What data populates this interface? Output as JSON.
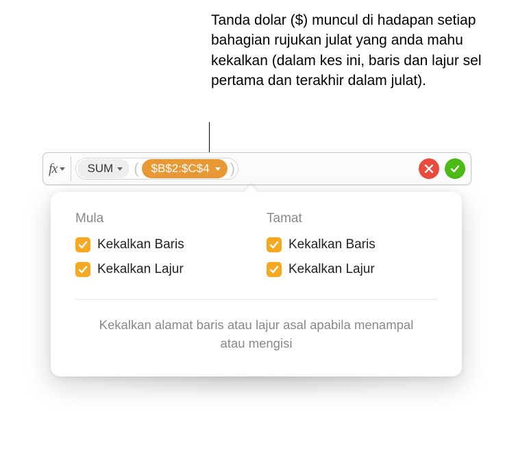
{
  "annotation": "Tanda dolar ($) muncul di hadapan setiap bahagian rujukan julat yang anda mahu kekalkan (dalam kes ini, baris dan lajur sel pertama dan terakhir dalam julat).",
  "formula_bar": {
    "fx_label": "fx",
    "func_name": "SUM",
    "open_paren": "(",
    "range_ref": "$B$2:$C$4",
    "close_paren": ")"
  },
  "popover": {
    "start_header": "Mula",
    "end_header": "Tamat",
    "start_options": [
      {
        "label": "Kekalkan Baris",
        "checked": true
      },
      {
        "label": "Kekalkan Lajur",
        "checked": true
      }
    ],
    "end_options": [
      {
        "label": "Kekalkan Baris",
        "checked": true
      },
      {
        "label": "Kekalkan Lajur",
        "checked": true
      }
    ],
    "description": "Kekalkan alamat baris atau lajur asal apabila menampal atau mengisi"
  },
  "colors": {
    "accent_orange": "#f7a823",
    "pill_orange": "#e79936",
    "cancel_red": "#e94b3c",
    "accept_green": "#4cbb17"
  }
}
